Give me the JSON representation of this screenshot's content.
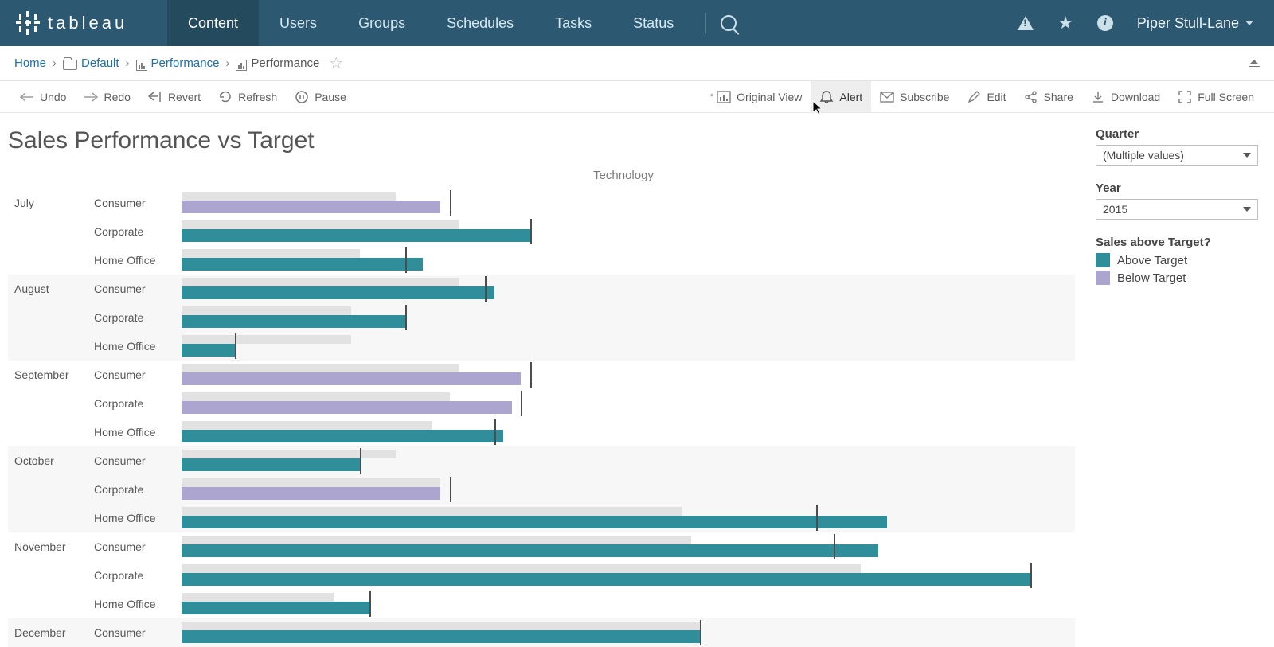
{
  "brand": "tableau",
  "nav": {
    "tabs": [
      "Content",
      "Users",
      "Groups",
      "Schedules",
      "Tasks",
      "Status"
    ],
    "active": 0,
    "user": "Piper Stull-Lane"
  },
  "breadcrumb": {
    "home": "Home",
    "folder": "Default",
    "workbook": "Performance",
    "view": "Performance"
  },
  "toolbar": {
    "undo": "Undo",
    "redo": "Redo",
    "revert": "Revert",
    "refresh": "Refresh",
    "pause": "Pause",
    "original": "Original View",
    "alert": "Alert",
    "subscribe": "Subscribe",
    "edit": "Edit",
    "share": "Share",
    "download": "Download",
    "fullscreen": "Full Screen"
  },
  "viz_title": "Sales Performance vs Target",
  "column_header": "Technology",
  "filters": {
    "quarter_label": "Quarter",
    "quarter_value": "(Multiple values)",
    "year_label": "Year",
    "year_value": "2015",
    "legend_title": "Sales above Target?",
    "legend_above": "Above Target",
    "legend_below": "Below Target"
  },
  "segments": [
    "Consumer",
    "Corporate",
    "Home Office"
  ],
  "chart_data": {
    "type": "bar",
    "title": "Sales Performance vs Target",
    "column": "Technology",
    "xlabel": "",
    "ylabel": "",
    "x_max": 100,
    "legend": [
      "Above Target",
      "Below Target"
    ],
    "series_meta": [
      "actual_sales_pct",
      "context_band_pct",
      "target_marker_pct"
    ],
    "months": [
      {
        "name": "July",
        "alt": false,
        "rows": [
          {
            "segment": "Consumer",
            "bg": 24,
            "fg": 29,
            "tick": 30,
            "above": false
          },
          {
            "segment": "Corporate",
            "bg": 31,
            "fg": 39,
            "tick": 39,
            "above": true
          },
          {
            "segment": "Home Office",
            "bg": 20,
            "fg": 27,
            "tick": 25,
            "above": true
          }
        ]
      },
      {
        "name": "August",
        "alt": true,
        "rows": [
          {
            "segment": "Consumer",
            "bg": 31,
            "fg": 35,
            "tick": 34,
            "above": true
          },
          {
            "segment": "Corporate",
            "bg": 19,
            "fg": 25,
            "tick": 25,
            "above": true
          },
          {
            "segment": "Home Office",
            "bg": 19,
            "fg": 6,
            "tick": 6,
            "above": true
          }
        ]
      },
      {
        "name": "September",
        "alt": false,
        "rows": [
          {
            "segment": "Consumer",
            "bg": 31,
            "fg": 38,
            "tick": 39,
            "above": false
          },
          {
            "segment": "Corporate",
            "bg": 30,
            "fg": 37,
            "tick": 38,
            "above": false
          },
          {
            "segment": "Home Office",
            "bg": 28,
            "fg": 36,
            "tick": 35,
            "above": true
          }
        ]
      },
      {
        "name": "October",
        "alt": true,
        "rows": [
          {
            "segment": "Consumer",
            "bg": 24,
            "fg": 20,
            "tick": 20,
            "above": true
          },
          {
            "segment": "Corporate",
            "bg": 29,
            "fg": 29,
            "tick": 30,
            "above": false
          },
          {
            "segment": "Home Office",
            "bg": 56,
            "fg": 79,
            "tick": 71,
            "above": true
          }
        ]
      },
      {
        "name": "November",
        "alt": false,
        "rows": [
          {
            "segment": "Consumer",
            "bg": 57,
            "fg": 78,
            "tick": 73,
            "above": true
          },
          {
            "segment": "Corporate",
            "bg": 76,
            "fg": 95,
            "tick": 95,
            "above": true
          },
          {
            "segment": "Home Office",
            "bg": 17,
            "fg": 21,
            "tick": 21,
            "above": true
          }
        ]
      },
      {
        "name": "December",
        "alt": true,
        "rows": [
          {
            "segment": "Consumer",
            "bg": 58,
            "fg": 58,
            "tick": 58,
            "above": true
          }
        ]
      }
    ]
  }
}
